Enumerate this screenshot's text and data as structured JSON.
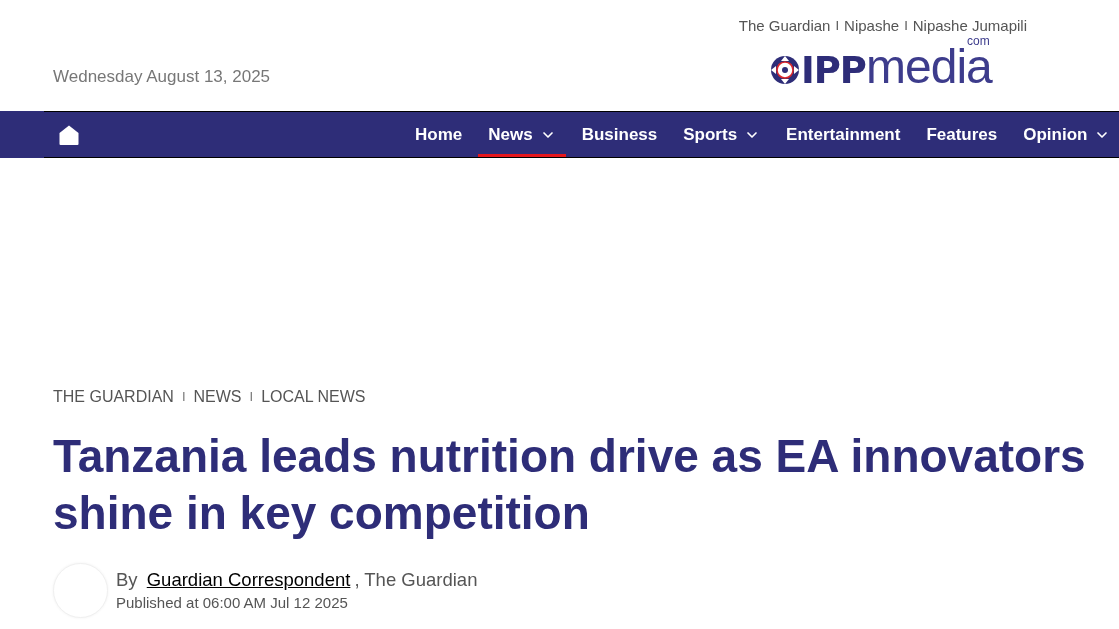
{
  "header": {
    "date": "Wednesday August 13, 2025",
    "sites": [
      {
        "kind": "link",
        "text": "The Guardian"
      },
      {
        "kind": "separator",
        "text": "I"
      },
      {
        "kind": "link",
        "text": "Nipashe"
      },
      {
        "kind": "separator",
        "text": "I"
      },
      {
        "kind": "link",
        "text": "Nipashe Jumapili"
      }
    ],
    "logo": {
      "bold_part": "IPP",
      "light_part": "media",
      "superscript": "com"
    }
  },
  "nav": {
    "items": [
      {
        "label": "Home",
        "selected": false,
        "dropdown": false
      },
      {
        "label": "News",
        "selected": true,
        "dropdown": true
      },
      {
        "label": "Business",
        "selected": false,
        "dropdown": false
      },
      {
        "label": "Sports",
        "selected": false,
        "dropdown": true
      },
      {
        "label": "Entertainment",
        "selected": false,
        "dropdown": false
      },
      {
        "label": "Features",
        "selected": false,
        "dropdown": false
      },
      {
        "label": "Opinion",
        "selected": false,
        "dropdown": true
      }
    ]
  },
  "article": {
    "breadcrumb": [
      {
        "kind": "link",
        "text": "THE GUARDIAN"
      },
      {
        "kind": "separator",
        "text": "I"
      },
      {
        "kind": "link",
        "text": "NEWS"
      },
      {
        "kind": "separator",
        "text": "I"
      },
      {
        "kind": "link",
        "text": "LOCAL NEWS"
      }
    ],
    "headline": "Tanzania leads nutrition drive as EA innovators shine in key competition",
    "byline": {
      "prefix": "By",
      "author": "Guardian Correspondent",
      "suffix": ", The Guardian"
    },
    "published": "Published at 06:00 AM Jul 12 2025"
  }
}
